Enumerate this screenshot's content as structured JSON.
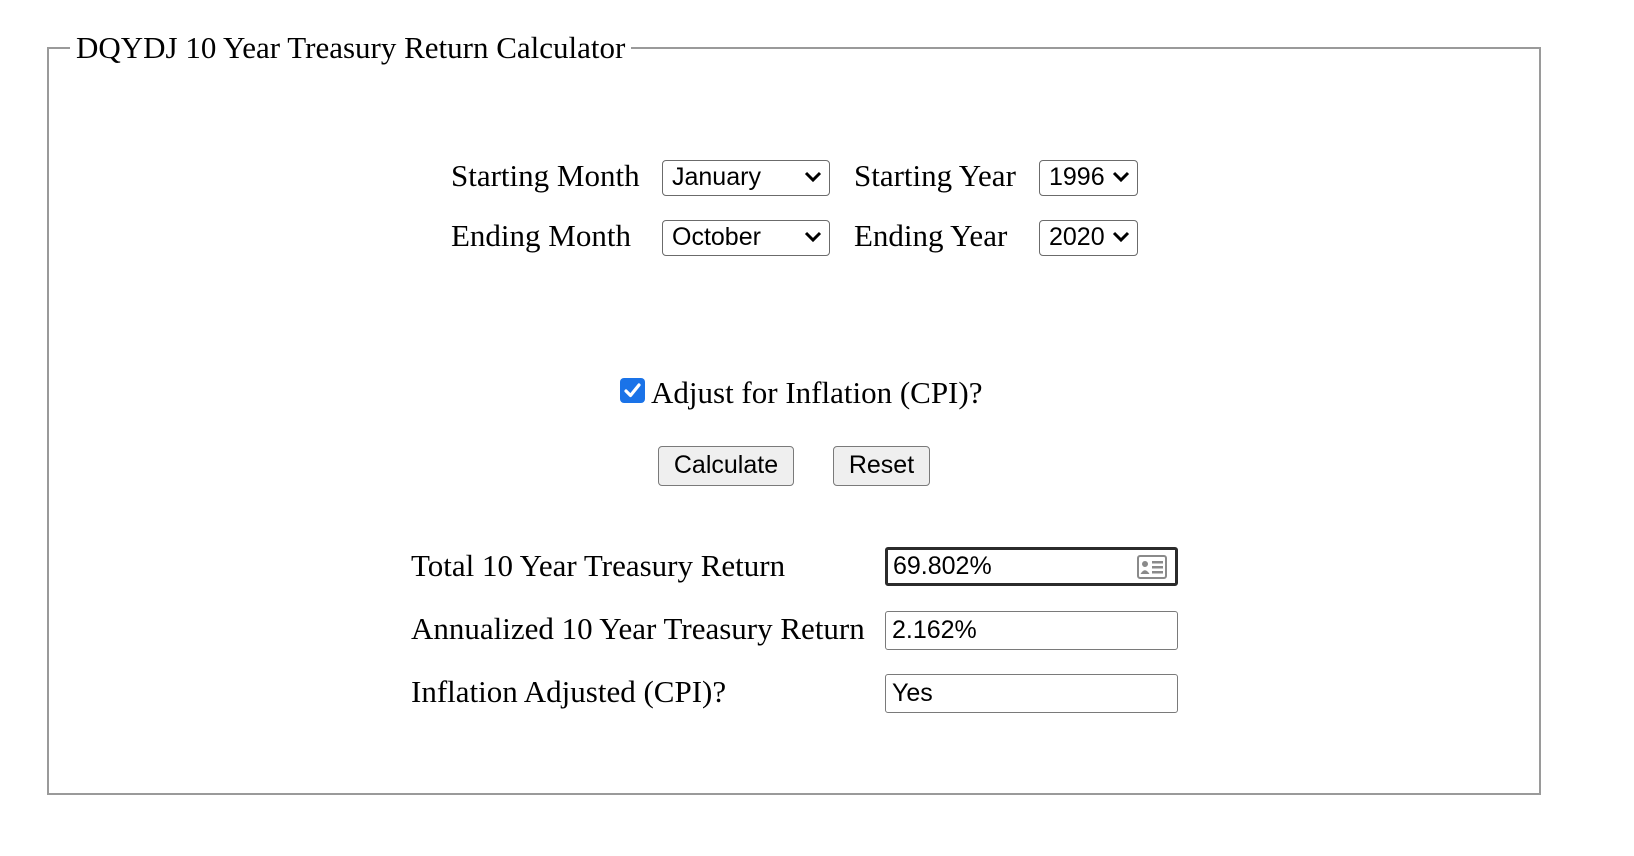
{
  "form": {
    "legend": "DQYDJ 10 Year Treasury Return Calculator",
    "starting_month": {
      "label": "Starting Month",
      "value": "January"
    },
    "starting_year": {
      "label": "Starting Year",
      "value": "1996"
    },
    "ending_month": {
      "label": "Ending Month",
      "value": "October"
    },
    "ending_year": {
      "label": "Ending Year",
      "value": "2020"
    },
    "inflation_checkbox": {
      "label": "Adjust for Inflation (CPI)?",
      "checked": true
    },
    "buttons": {
      "calculate": "Calculate",
      "reset": "Reset"
    },
    "results": {
      "total": {
        "label": "Total 10 Year Treasury Return",
        "value": "69.802%"
      },
      "annualized": {
        "label": "Annualized 10 Year Treasury Return",
        "value": "2.162%"
      },
      "inflation_adjusted": {
        "label": "Inflation Adjusted (CPI)?",
        "value": "Yes"
      }
    }
  },
  "icons": {
    "select_arrow": "chevron-down-icon",
    "checkbox_mark": "checkmark-icon",
    "autofill": "contact-card-icon"
  },
  "colors": {
    "checkbox_accent": "#1a73e8",
    "frame_border": "#9a9a9a",
    "button_bg": "#efefef"
  }
}
